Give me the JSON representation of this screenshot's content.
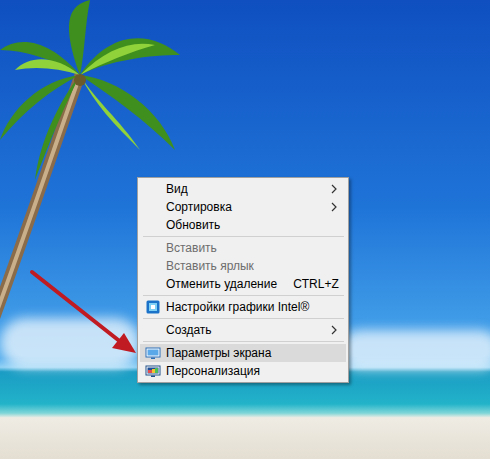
{
  "desktop": {
    "wallpaper": "beach"
  },
  "context_menu": {
    "items": [
      {
        "kind": "item",
        "label": "Вид",
        "submenu": true,
        "disabled": false,
        "highlighted": false,
        "shortcut": ""
      },
      {
        "kind": "item",
        "label": "Сортировка",
        "submenu": true,
        "disabled": false,
        "highlighted": false,
        "shortcut": ""
      },
      {
        "kind": "item",
        "label": "Обновить",
        "submenu": false,
        "disabled": false,
        "highlighted": false,
        "shortcut": ""
      },
      {
        "kind": "separator"
      },
      {
        "kind": "item",
        "label": "Вставить",
        "submenu": false,
        "disabled": true,
        "highlighted": false,
        "shortcut": ""
      },
      {
        "kind": "item",
        "label": "Вставить ярлык",
        "submenu": false,
        "disabled": true,
        "highlighted": false,
        "shortcut": ""
      },
      {
        "kind": "item",
        "label": "Отменить удаление",
        "submenu": false,
        "disabled": false,
        "highlighted": false,
        "shortcut": "CTRL+Z"
      },
      {
        "kind": "separator"
      },
      {
        "kind": "intel-item",
        "label": "Настройки графики Intel®",
        "submenu": false,
        "disabled": false,
        "highlighted": false,
        "shortcut": ""
      },
      {
        "kind": "separator"
      },
      {
        "kind": "item",
        "label": "Создать",
        "submenu": true,
        "disabled": false,
        "highlighted": false,
        "shortcut": ""
      },
      {
        "kind": "separator"
      },
      {
        "kind": "display-item",
        "label": "Параметры экрана",
        "submenu": false,
        "disabled": false,
        "highlighted": true,
        "shortcut": ""
      },
      {
        "kind": "personalize-item",
        "label": "Персонализация",
        "submenu": false,
        "disabled": false,
        "highlighted": false,
        "shortcut": ""
      }
    ]
  }
}
